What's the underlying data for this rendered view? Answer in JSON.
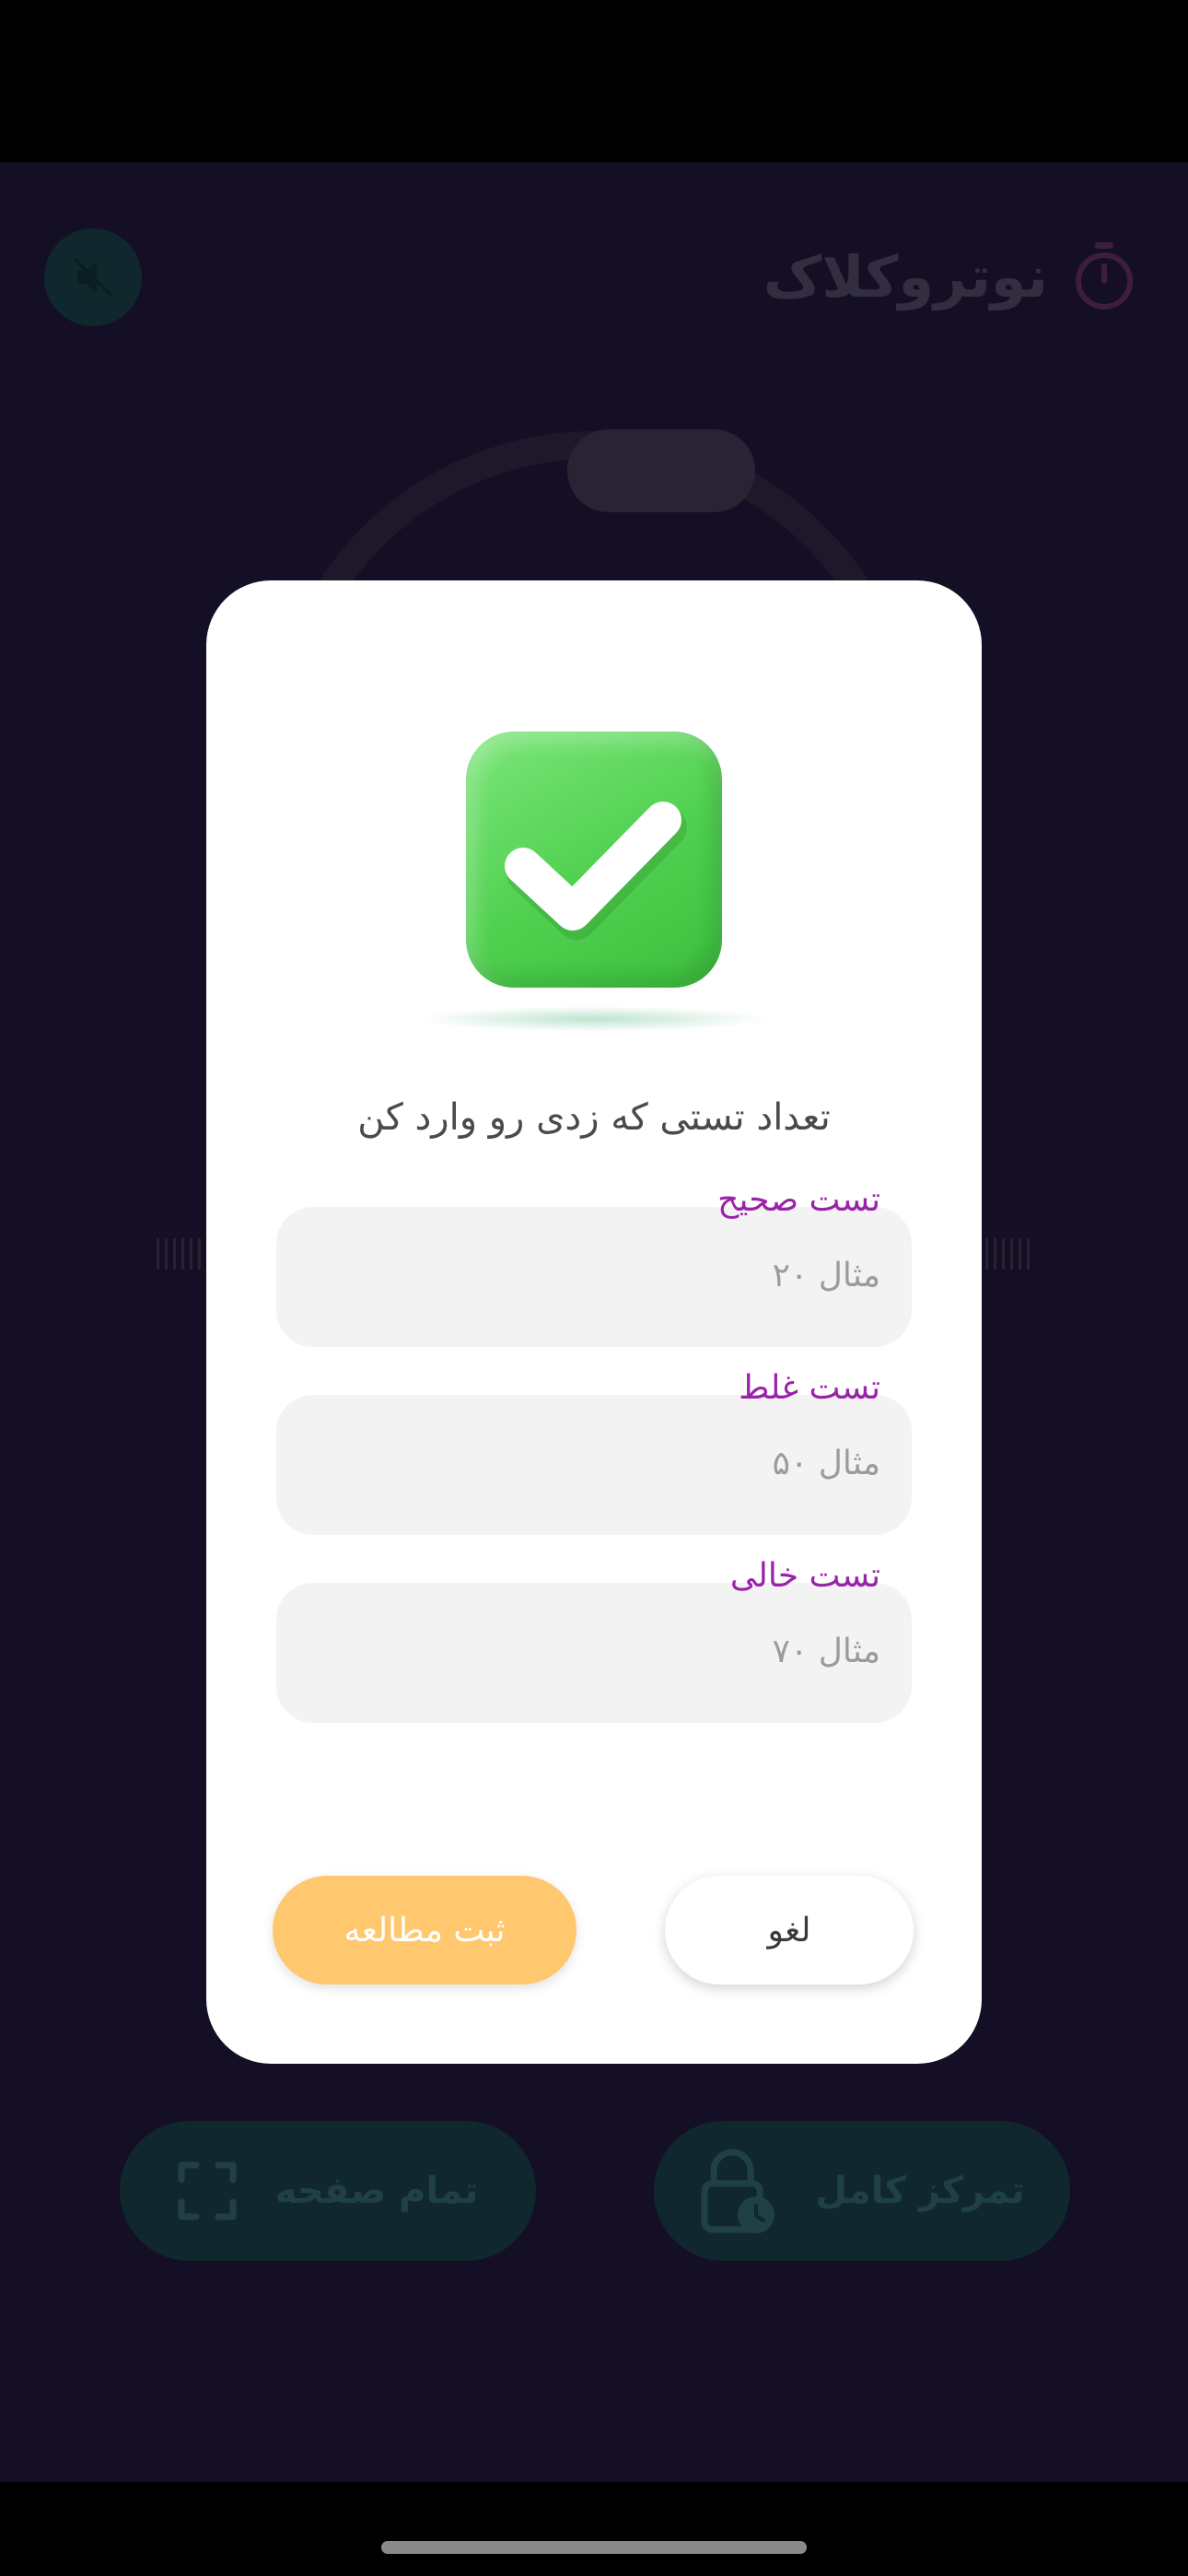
{
  "app": {
    "title": "نوتروکلاک"
  },
  "background_buttons": {
    "fullscreen_label": "تمام صفحه",
    "focus_label": "تمرکز کامل"
  },
  "dialog": {
    "title": "تعداد تستی که زدی رو وارد کن",
    "fields": [
      {
        "label": "تست صحیح",
        "placeholder": "مثال ۲۰"
      },
      {
        "label": "تست غلط",
        "placeholder": "مثال ۵۰"
      },
      {
        "label": "تست خالی",
        "placeholder": "مثال ۷۰"
      }
    ],
    "cancel_label": "لغو",
    "save_label": "ثبت مطالعه"
  },
  "colors": {
    "background": "#1c1430",
    "accent_teal": "#153a3c",
    "label_purple": "#9a22a8",
    "save_button": "#ffc86e",
    "check_green": "#4fd04e"
  }
}
